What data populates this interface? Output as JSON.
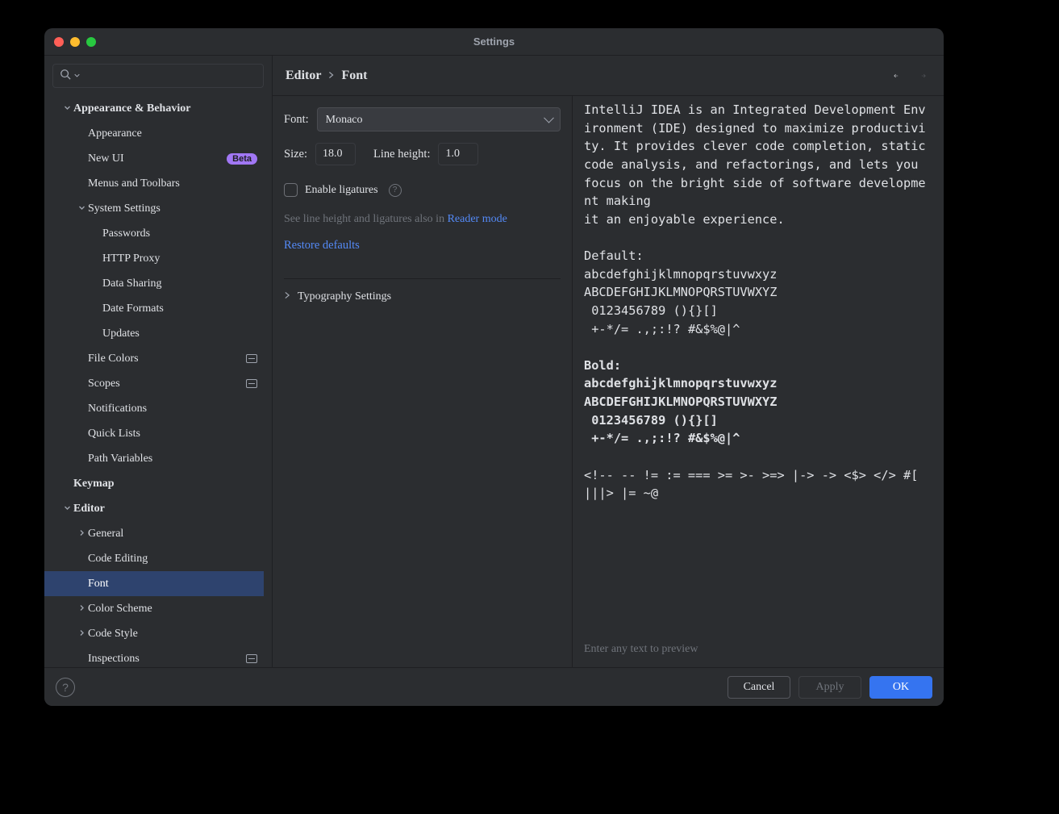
{
  "window_title": "Settings",
  "search": {
    "placeholder": ""
  },
  "sidebar": {
    "items": [
      {
        "label": "Appearance & Behavior",
        "depth": 0,
        "arrow": "down",
        "bold": true
      },
      {
        "label": "Appearance",
        "depth": 1
      },
      {
        "label": "New UI",
        "depth": 1,
        "badge": "Beta"
      },
      {
        "label": "Menus and Toolbars",
        "depth": 1
      },
      {
        "label": "System Settings",
        "depth": 1,
        "arrow": "down"
      },
      {
        "label": "Passwords",
        "depth": 2
      },
      {
        "label": "HTTP Proxy",
        "depth": 2
      },
      {
        "label": "Data Sharing",
        "depth": 2
      },
      {
        "label": "Date Formats",
        "depth": 2
      },
      {
        "label": "Updates",
        "depth": 2
      },
      {
        "label": "File Colors",
        "depth": 1,
        "trailing_icon": true
      },
      {
        "label": "Scopes",
        "depth": 1,
        "trailing_icon": true
      },
      {
        "label": "Notifications",
        "depth": 1
      },
      {
        "label": "Quick Lists",
        "depth": 1
      },
      {
        "label": "Path Variables",
        "depth": 1
      },
      {
        "label": "Keymap",
        "depth": 0,
        "bold": true
      },
      {
        "label": "Editor",
        "depth": 0,
        "arrow": "down",
        "bold": true
      },
      {
        "label": "General",
        "depth": 1,
        "arrow": "right"
      },
      {
        "label": "Code Editing",
        "depth": 1
      },
      {
        "label": "Font",
        "depth": 1,
        "selected": true
      },
      {
        "label": "Color Scheme",
        "depth": 1,
        "arrow": "right"
      },
      {
        "label": "Code Style",
        "depth": 1,
        "arrow": "right"
      },
      {
        "label": "Inspections",
        "depth": 1,
        "trailing_icon": true
      }
    ]
  },
  "breadcrumb": {
    "parent": "Editor",
    "current": "Font"
  },
  "form": {
    "font_label": "Font:",
    "font_value": "Monaco",
    "size_label": "Size:",
    "size_value": "18.0",
    "line_height_label": "Line height:",
    "line_height_value": "1.0",
    "ligatures_label": "Enable ligatures",
    "hint_prefix": "See line height and ligatures also in ",
    "hint_link": "Reader mode",
    "restore": "Restore defaults",
    "typography": "Typography Settings"
  },
  "preview": {
    "p1": "IntelliJ IDEA is an Integrated Development Environment (IDE) designed to maximize productivity. It provides clever code completion, static code analysis, and refactorings, and lets you focus on the bright side of software development making",
    "p1b": "it an enjoyable experience.",
    "def_label": "Default:",
    "def_l1": "abcdefghijklmnopqrstuvwxyz",
    "def_l2": "ABCDEFGHIJKLMNOPQRSTUVWXYZ",
    "def_l3": " 0123456789 (){}[]",
    "def_l4": " +-*/= .,;:!? #&$%@|^",
    "bold_label": "Bold:",
    "bold_l1": "abcdefghijklmnopqrstuvwxyz",
    "bold_l2": "ABCDEFGHIJKLMNOPQRSTUVWXYZ",
    "bold_l3": " 0123456789 (){}[]",
    "bold_l4": " +-*/= .,;:!? #&$%@|^",
    "lig1": "<!-- -- != := === >= >- >=> |-> -> <$> </> #[ |||> |= ~@",
    "hint": "Enter any text to preview"
  },
  "footer": {
    "cancel": "Cancel",
    "apply": "Apply",
    "ok": "OK"
  }
}
